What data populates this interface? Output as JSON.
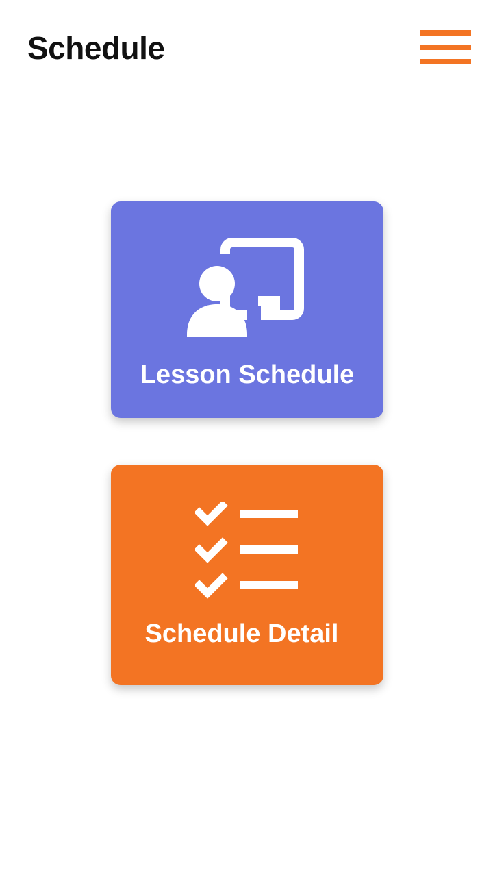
{
  "header": {
    "title": "Schedule",
    "menu_icon": "hamburger-menu-icon"
  },
  "cards": [
    {
      "label": "Lesson Schedule",
      "icon": "teacher-whiteboard-icon",
      "color": "#6B75E0"
    },
    {
      "label": "Schedule Detail",
      "icon": "checklist-icon",
      "color": "#F37423"
    }
  ],
  "colors": {
    "accent": "#F37423",
    "lesson_card": "#6B75E0",
    "detail_card": "#F37423",
    "title_text": "#111111",
    "background": "#FFFFFF"
  }
}
